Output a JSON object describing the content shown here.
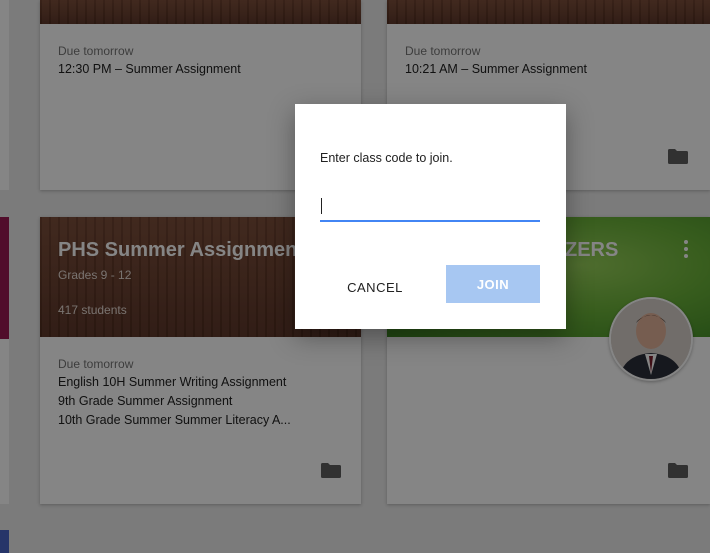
{
  "cards": {
    "top_left": {
      "due_label": "Due tomorrow",
      "assignments": [
        "12:30 PM – Summer Assignment"
      ]
    },
    "top_right": {
      "due_label": "Due tomorrow",
      "assignments": [
        "10:21 AM – Summer Assignment"
      ]
    },
    "bottom_left": {
      "title": "PHS Summer Assignmen",
      "section": "Grades 9 - 12",
      "students": "417 students",
      "due_label": "Due tomorrow",
      "assignments": [
        "English 10H Summer Writing Assignment",
        "9th Grade Summer Assignment",
        "10th Grade Summer Summer Literacy A..."
      ]
    },
    "bottom_right": {
      "title_visible": "ZERS",
      "menu_icon": "more-vert-icon",
      "avatar_icon": "teacher-avatar"
    }
  },
  "dialog": {
    "prompt": "Enter class code to join.",
    "input_value": "",
    "cancel_label": "CANCEL",
    "join_label": "JOIN"
  },
  "colors": {
    "join_disabled": "#a7c7f2",
    "input_focus": "#4285f4",
    "strip_top": "#5c4bb0",
    "strip_mid": "#b0145c",
    "strip_bottom": "#3f6ad8"
  },
  "icons": {
    "folder": "folder-icon"
  }
}
